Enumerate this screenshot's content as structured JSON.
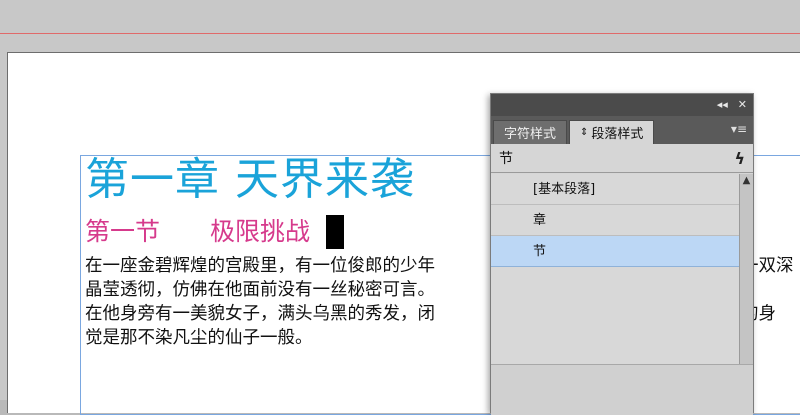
{
  "document": {
    "chapter_title": "第一章 天界来袭",
    "section_title": "第一节　　极限挑战",
    "body_lines": [
      {
        "left": "在一座金碧辉煌的宫殿里，有一位俊郎的少年",
        "right": "一双深"
      },
      {
        "left": "晶莹透彻，仿佛在他面前没有一丝秘密可言。",
        "right": ""
      },
      {
        "left": "在他身旁有一美貌女子，满头乌黑的秀发，闭",
        "right": "的身"
      },
      {
        "left": "觉是那不染凡尘的仙子一般。",
        "right": ""
      }
    ]
  },
  "panel": {
    "collapse_icon": "double-chevron-icon",
    "close_label": "✕",
    "collapse_label": "◂◂",
    "tabs": [
      {
        "label": "字符样式",
        "active": false
      },
      {
        "label": "段落样式",
        "active": true
      }
    ],
    "menu_label": "▾≡",
    "current_style": "节",
    "quick_apply_label": "ϟ",
    "styles": [
      {
        "label": "[基本段落]",
        "selected": false
      },
      {
        "label": "章",
        "selected": false
      },
      {
        "label": "节",
        "selected": true
      }
    ],
    "scroll_up_label": "▲"
  }
}
